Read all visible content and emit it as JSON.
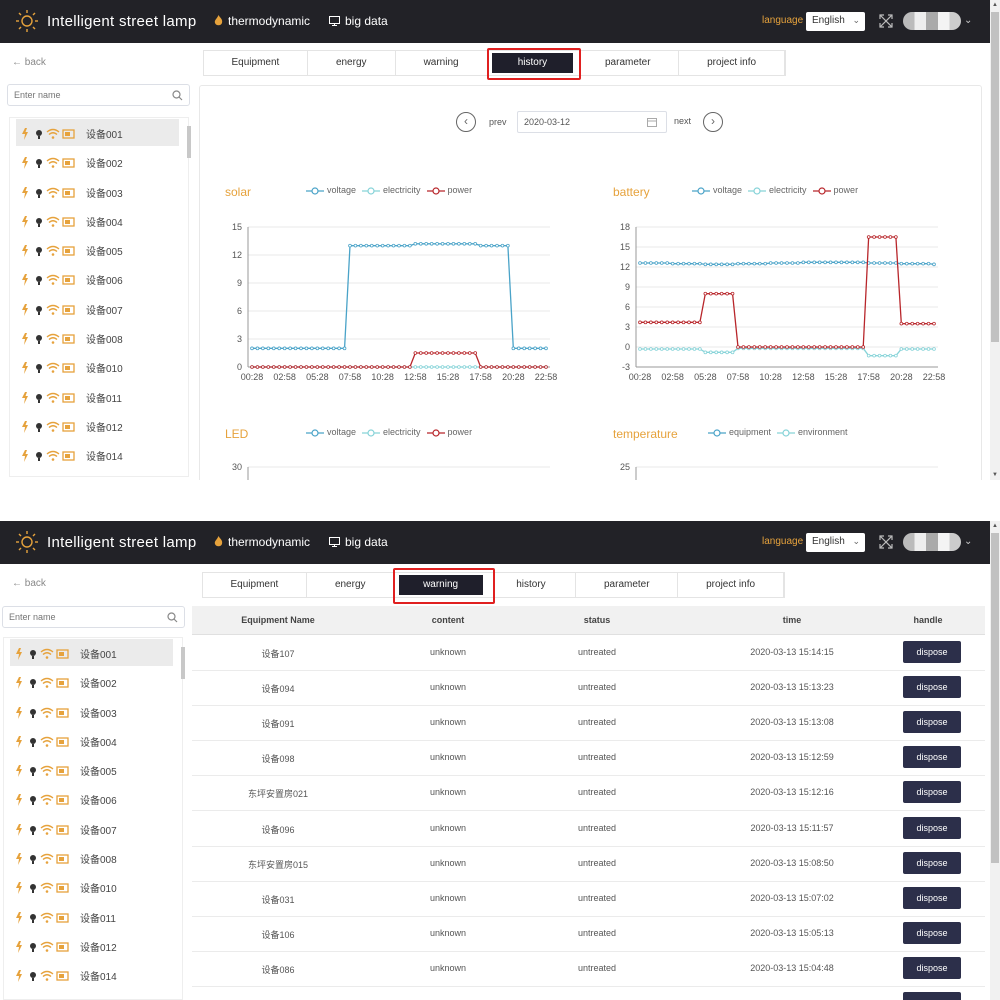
{
  "app": {
    "title": "Intelligent street lamp"
  },
  "nav": {
    "thermodynamic": "thermodynamic",
    "bigdata": "big data"
  },
  "lang": {
    "label": "language",
    "selected": "English"
  },
  "back": "back",
  "search": {
    "placeholder": "Enter name"
  },
  "devices": [
    "设备001",
    "设备002",
    "设备003",
    "设备004",
    "设备005",
    "设备006",
    "设备007",
    "设备008",
    "设备010",
    "设备011",
    "设备012",
    "设备014"
  ],
  "tabs": [
    "Equipment",
    "energy",
    "warning",
    "history",
    "parameter",
    "project info"
  ],
  "history": {
    "prev": "prev",
    "next": "next",
    "date": "2020-03-12",
    "charts": {
      "solar": {
        "title": "solar",
        "legend": [
          "voltage",
          "electricity",
          "power"
        ]
      },
      "battery": {
        "title": "battery",
        "legend": [
          "voltage",
          "electricity",
          "power"
        ]
      },
      "led": {
        "title": "LED",
        "legend": [
          "voltage",
          "electricity",
          "power"
        ]
      },
      "temperature": {
        "title": "temperature",
        "legend": [
          "equipment",
          "environment"
        ]
      }
    }
  },
  "colors": {
    "voltage": "#4aa3c8",
    "electricity": "#86d3d8",
    "power": "#b8262b",
    "accent": "#e6a23c",
    "topbar": "#222227"
  },
  "chart_data": [
    {
      "type": "line",
      "title": "solar",
      "x": [
        "00:28",
        "02:58",
        "05:28",
        "07:58",
        "10:28",
        "12:58",
        "15:28",
        "17:58",
        "20:28",
        "22:58"
      ],
      "ylim": [
        0,
        15
      ],
      "yticks": [
        0,
        3,
        6,
        9,
        12,
        15
      ],
      "series": [
        {
          "name": "voltage",
          "values": [
            2,
            2,
            2,
            13,
            13,
            13.2,
            13.2,
            13,
            2,
            2
          ]
        },
        {
          "name": "electricity",
          "values": [
            0,
            0,
            0,
            0,
            0,
            0,
            0,
            0,
            0,
            0
          ]
        },
        {
          "name": "power",
          "values": [
            0,
            0,
            0,
            0,
            0,
            1.5,
            1.5,
            0,
            0,
            0
          ]
        }
      ]
    },
    {
      "type": "line",
      "title": "battery",
      "x": [
        "00:28",
        "02:58",
        "05:28",
        "07:58",
        "10:28",
        "12:58",
        "15:28",
        "17:58",
        "20:28",
        "22:58"
      ],
      "ylim": [
        -3,
        18
      ],
      "yticks": [
        -3,
        0,
        3,
        6,
        9,
        12,
        15,
        18
      ],
      "series": [
        {
          "name": "voltage",
          "values": [
            12.6,
            12.5,
            12.4,
            12.5,
            12.6,
            12.7,
            12.7,
            12.6,
            12.5,
            12.4
          ]
        },
        {
          "name": "electricity",
          "values": [
            -0.3,
            -0.3,
            -0.8,
            -0.2,
            -0.2,
            -0.2,
            -0.2,
            -1.3,
            -0.3,
            -0.3
          ]
        },
        {
          "name": "power",
          "values": [
            3.7,
            3.7,
            8,
            0,
            0,
            0,
            0,
            16.5,
            3.5,
            3.5
          ]
        }
      ]
    },
    {
      "type": "line",
      "title": "LED",
      "x": [],
      "yticks": [
        30
      ],
      "series": [
        {
          "name": "voltage",
          "values": []
        },
        {
          "name": "electricity",
          "values": []
        },
        {
          "name": "power",
          "values": []
        }
      ]
    },
    {
      "type": "line",
      "title": "temperature",
      "x": [],
      "yticks": [
        25
      ],
      "series": [
        {
          "name": "equipment",
          "values": []
        },
        {
          "name": "environment",
          "values": []
        }
      ]
    }
  ],
  "warning": {
    "headers": [
      "Equipment Name",
      "content",
      "status",
      "time",
      "handle"
    ],
    "rows": [
      {
        "name": "设备107",
        "content": "unknown",
        "status": "untreated",
        "time": "2020-03-13 15:14:15",
        "handle": "dispose"
      },
      {
        "name": "设备094",
        "content": "unknown",
        "status": "untreated",
        "time": "2020-03-13 15:13:23",
        "handle": "dispose"
      },
      {
        "name": "设备091",
        "content": "unknown",
        "status": "untreated",
        "time": "2020-03-13 15:13:08",
        "handle": "dispose"
      },
      {
        "name": "设备098",
        "content": "unknown",
        "status": "untreated",
        "time": "2020-03-13 15:12:59",
        "handle": "dispose"
      },
      {
        "name": "东坪安置房021",
        "content": "unknown",
        "status": "untreated",
        "time": "2020-03-13 15:12:16",
        "handle": "dispose"
      },
      {
        "name": "设备096",
        "content": "unknown",
        "status": "untreated",
        "time": "2020-03-13 15:11:57",
        "handle": "dispose"
      },
      {
        "name": "东坪安置房015",
        "content": "unknown",
        "status": "untreated",
        "time": "2020-03-13 15:08:50",
        "handle": "dispose"
      },
      {
        "name": "设备031",
        "content": "unknown",
        "status": "untreated",
        "time": "2020-03-13 15:07:02",
        "handle": "dispose"
      },
      {
        "name": "设备106",
        "content": "unknown",
        "status": "untreated",
        "time": "2020-03-13 15:05:13",
        "handle": "dispose"
      },
      {
        "name": "设备086",
        "content": "unknown",
        "status": "untreated",
        "time": "2020-03-13 15:04:48",
        "handle": "dispose"
      }
    ]
  }
}
